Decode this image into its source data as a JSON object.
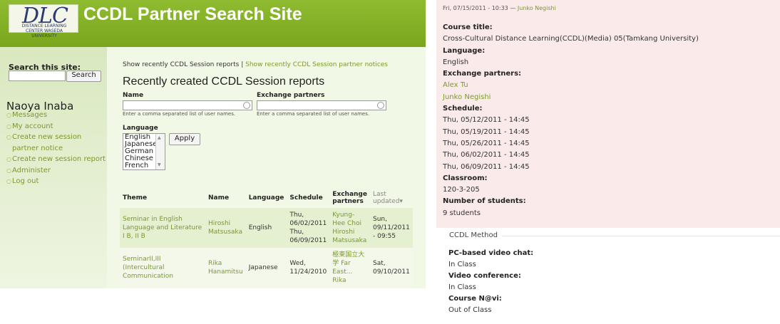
{
  "header": {
    "logo_text": "DLC",
    "logo_subtext": "DISTANCE LEARNING CENTER WASEDA UNIVERSITY",
    "site_title": "CCDL Partner Search Site"
  },
  "sidebar": {
    "search_label": "Search this site:",
    "search_value": "",
    "search_button": "Search",
    "user_name": "Naoya Inaba",
    "menu": [
      {
        "label": "Messages"
      },
      {
        "label": "My account"
      },
      {
        "label": "Create new session partner notice"
      },
      {
        "label": "Create new session report"
      },
      {
        "label": "Administer"
      },
      {
        "label": "Log out"
      }
    ]
  },
  "content": {
    "links": {
      "current": "Show recently CCDL Session reports",
      "separator": "|",
      "other": "Show recently CCDL Session partner notices"
    },
    "page_title": "Recently created CCDL Session reports",
    "filters": {
      "name_label": "Name",
      "partners_label": "Exchange partners",
      "name_value": "",
      "partners_value": "",
      "name_desc": "Enter a comma separated list of user names.",
      "partners_desc": "Enter a comma separated list of user names.",
      "language_label": "Language",
      "language_options": [
        "English",
        "Japanese",
        "German",
        "Chinese",
        "French"
      ],
      "apply_button": "Apply"
    },
    "table": {
      "headers": {
        "theme": "Theme",
        "name": "Name",
        "language": "Language",
        "schedule": "Schedule",
        "partners": "Exchange partners",
        "updated": "Last updated"
      },
      "rows": [
        {
          "theme": "Seminar in English Language and Literature I B, II B",
          "name": "Hiroshi Matsusaka",
          "language": "English",
          "schedule": [
            "Thu, 06/02/2011",
            "Thu, 06/09/2011"
          ],
          "partners": [
            "Kyung-Hee Choi",
            "Hiroshi Matsusaka"
          ],
          "updated": "Sun, 09/11/2011 - 09:55"
        },
        {
          "theme": "SeminarII,III (Intercultural Communication",
          "name": "Rika Hanamitsu",
          "language": "Japanese",
          "schedule": [
            "Wed, 11/24/2010"
          ],
          "partners": [
            "極東国立大学 Far East...",
            "Rika"
          ],
          "updated": "Sat, 09/10/2011"
        }
      ]
    }
  },
  "detail": {
    "meta_date": "Fri, 07/15/2011 - 10:33",
    "meta_dash": "—",
    "meta_author": "Junko Negishi",
    "course_title_label": "Course title:",
    "course_title": "Cross-Cultural Distance Learning(CCDL)(Media) 05(Tamkang University)",
    "language_label": "Language:",
    "language": "English",
    "partners_label": "Exchange partners:",
    "partners": [
      "Alex Tu",
      "Junko Negishi"
    ],
    "schedule_label": "Schedule:",
    "schedule": [
      "Thu, 05/12/2011 - 14:45",
      "Thu, 05/19/2011 - 14:45",
      "Thu, 05/26/2011 - 14:45",
      "Thu, 06/02/2011 - 14:45",
      "Thu, 06/09/2011 - 14:45"
    ],
    "classroom_label": "Classroom:",
    "classroom": "120-3-205",
    "students_label": "Number of students:",
    "students": "9 students",
    "method": {
      "legend": "CCDL Method",
      "pc_label": "PC-based video chat:",
      "pc_value": "In Class",
      "vc_label": "Video conference:",
      "vc_value": "In Class",
      "navi_label": "Course N@vi:",
      "navi_value": "Out of Class"
    }
  }
}
